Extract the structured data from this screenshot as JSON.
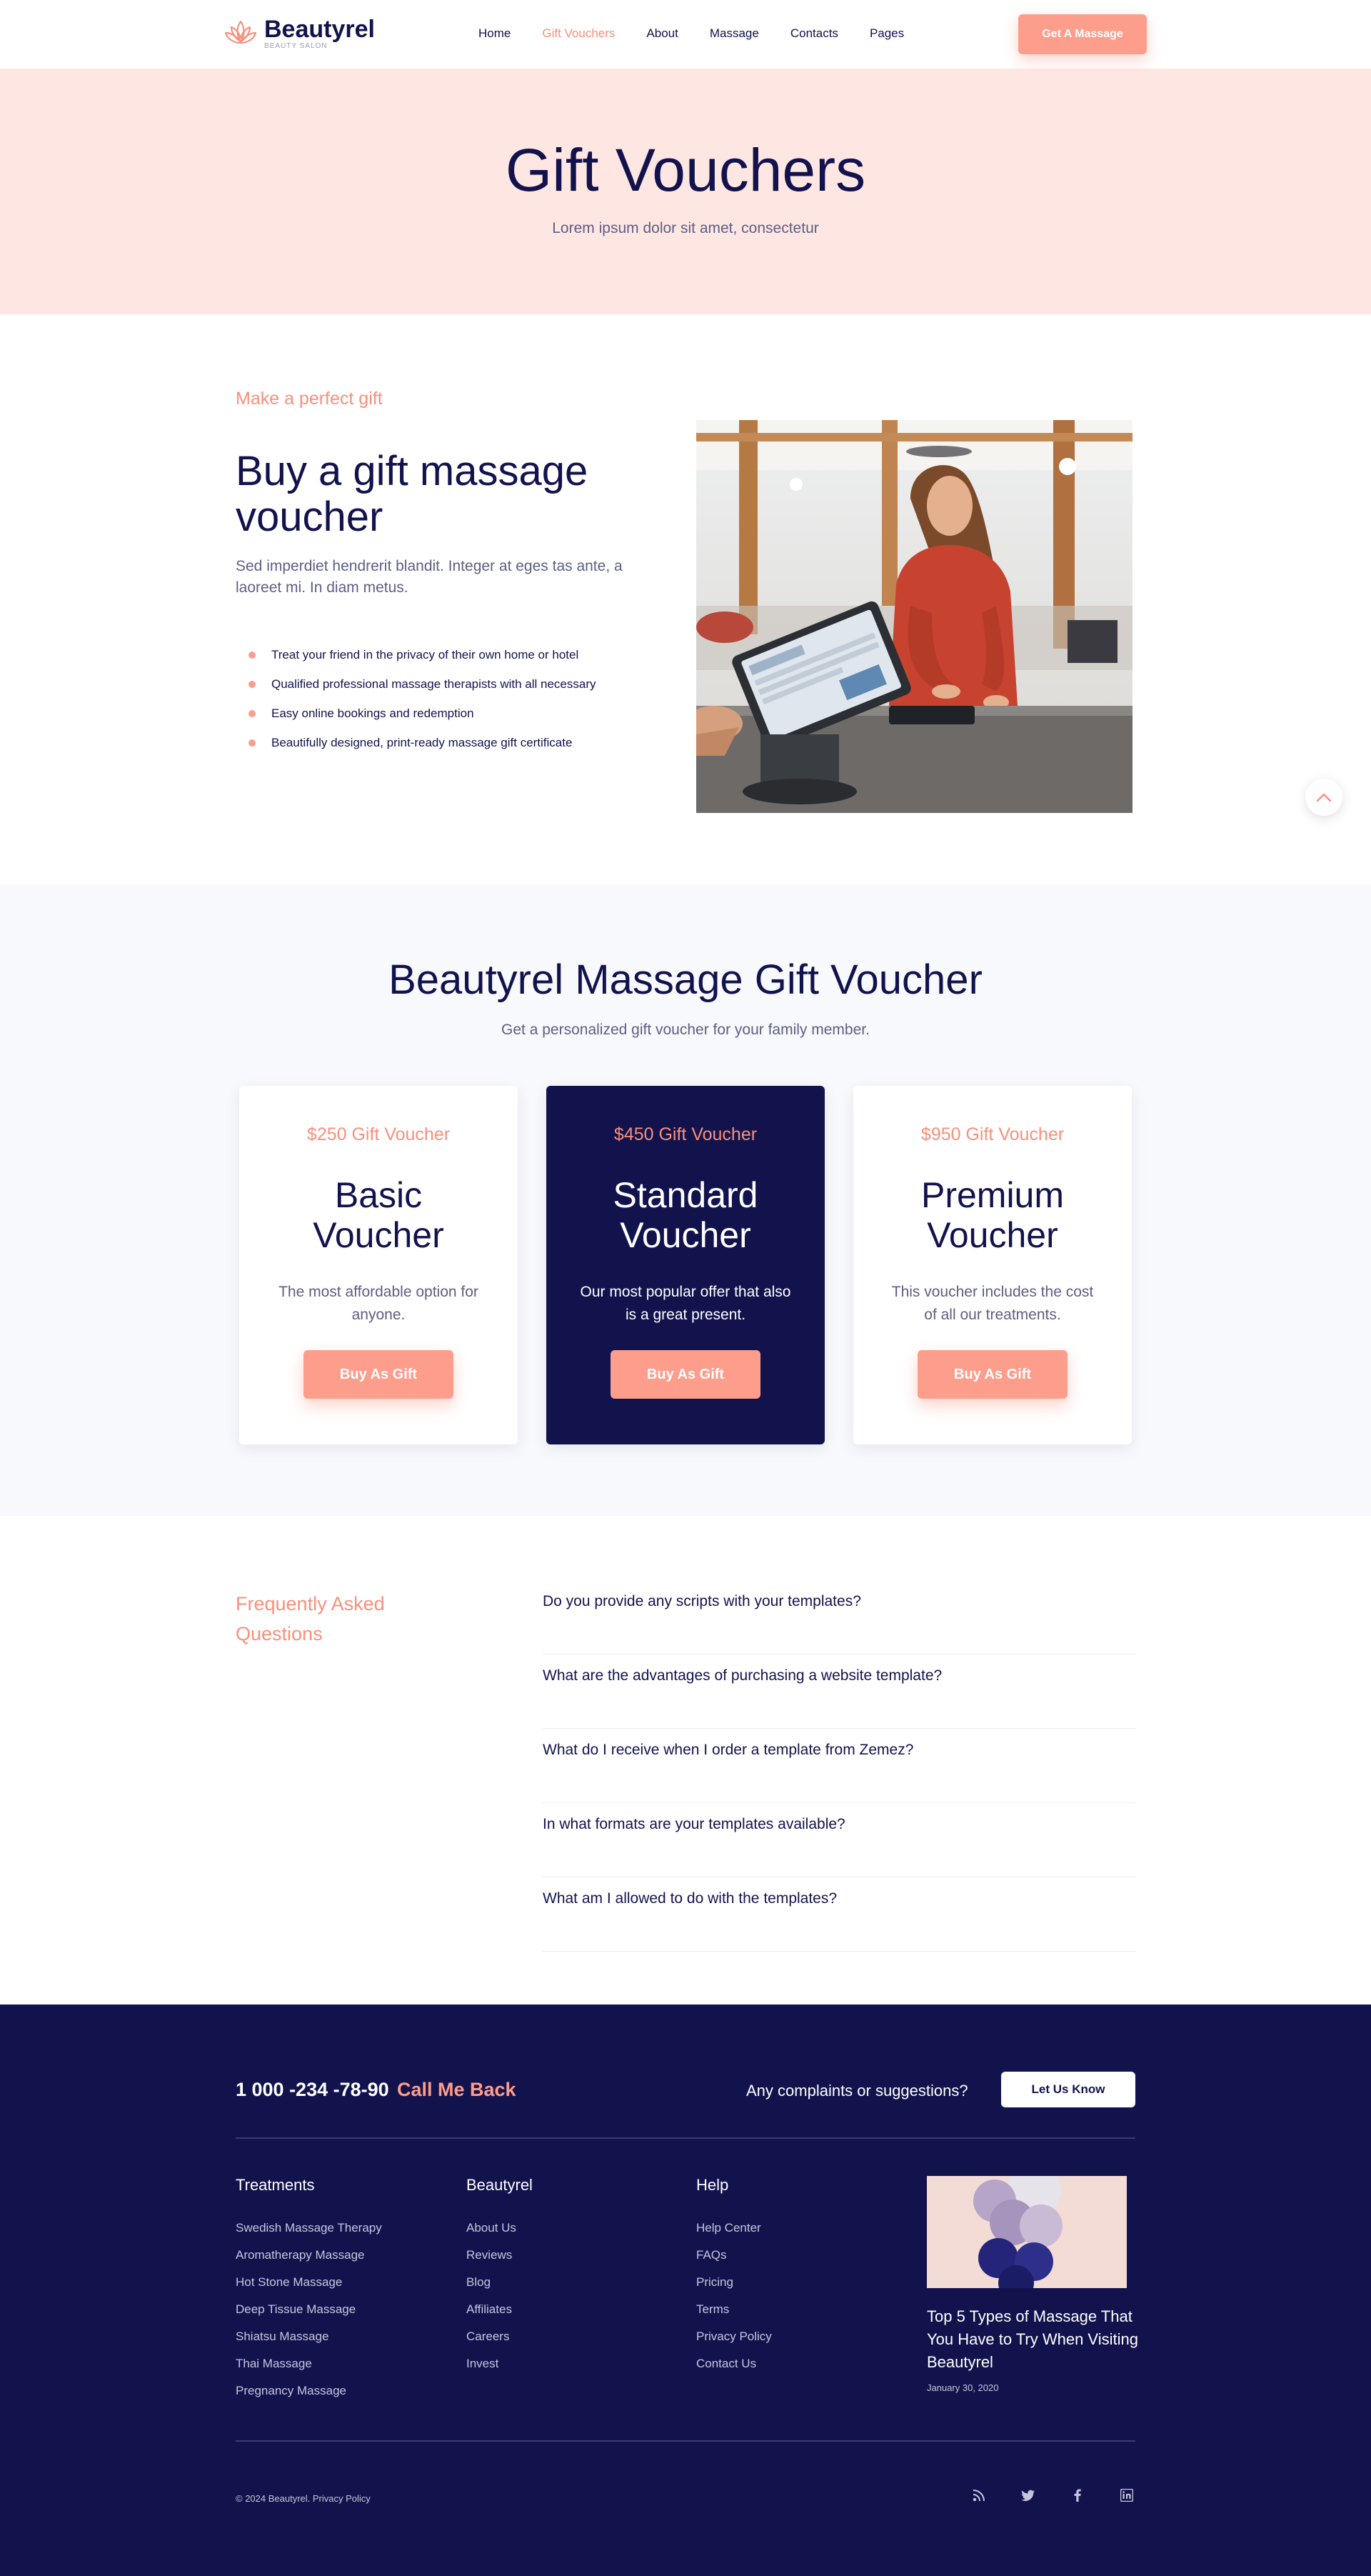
{
  "header": {
    "brand": "Beautyrel",
    "brand_sub": "BEAUTY SALON",
    "nav": [
      "Home",
      "Gift Vouchers",
      "About",
      "Massage",
      "Contacts",
      "Pages"
    ],
    "nav_active": "Gift Vouchers",
    "cta": "Get A Massage"
  },
  "hero": {
    "title": "Gift Vouchers",
    "subtitle": "Lorem ipsum dolor sit amet, consectetur"
  },
  "intro": {
    "eyebrow": "Make a perfect gift",
    "title": "Buy a gift massage voucher",
    "lead": "Sed imperdiet hendrerit blandit. Integer at eges tas ante, a laoreet mi. In diam metus.",
    "bullets": [
      "Treat your friend in the privacy of their own home or hotel",
      "Qualified professional massage therapists with all necessary",
      "Easy online bookings and redemption",
      "Beautifully designed, print-ready massage gift certificate"
    ]
  },
  "vouchers": {
    "title": "Beautyrel Massage Gift Voucher",
    "subtitle": "Get a personalized gift voucher for your family member.",
    "cards": [
      {
        "price": "$250 Gift Voucher",
        "name": "Basic Voucher",
        "desc": "The most affordable option for anyone.",
        "button": "Buy As Gift"
      },
      {
        "price": "$450 Gift Voucher",
        "name": "Standard Voucher",
        "desc": "Our most popular offer that also is a great present.",
        "button": "Buy As Gift"
      },
      {
        "price": "$950 Gift Voucher",
        "name": "Premium Voucher",
        "desc": "This voucher includes the cost of all our treatments.",
        "button": "Buy As Gift"
      }
    ]
  },
  "faq": {
    "title": "Frequently Asked Questions",
    "questions": [
      "Do you provide any scripts with your templates?",
      "What are the advantages of purchasing a website template?",
      "What do I receive when I order a template from Zemez?",
      "In what formats are your templates available?",
      "What am I allowed to do with the templates?"
    ]
  },
  "footer": {
    "phone": "1 000 -234 -78-90",
    "callback": "Call Me Back",
    "complaints": "Any complaints or suggestions?",
    "letus": "Let Us Know",
    "columns": [
      {
        "title": "Treatments",
        "links": [
          "Swedish Massage Therapy",
          "Aromatherapy Massage",
          "Hot Stone Massage",
          "Deep Tissue Massage",
          "Shiatsu Massage",
          "Thai Massage",
          "Pregnancy Massage"
        ]
      },
      {
        "title": "Beautyrel",
        "links": [
          "About Us",
          "Reviews",
          "Blog",
          "Affiliates",
          "Careers",
          "Invest"
        ]
      },
      {
        "title": "Help",
        "links": [
          "Help Center",
          "FAQs",
          "Pricing",
          "Terms",
          "Privacy Policy",
          "Contact Us"
        ]
      }
    ],
    "post": {
      "title": "Top 5 Types of Massage That You Have to Try When Visiting Beautyrel",
      "date": "January 30, 2020"
    },
    "copyright": "© 2024 Beautyrel. Privacy Policy",
    "socials": [
      "rss-icon",
      "twitter-icon",
      "facebook-icon",
      "linkedin-icon"
    ]
  },
  "colors": {
    "navy": "#12134d",
    "coral": "#fd9d8c",
    "coral_text": "#fa8f7b",
    "hero_bg": "#fee7e3",
    "muted_bg": "#f8f9fc"
  }
}
